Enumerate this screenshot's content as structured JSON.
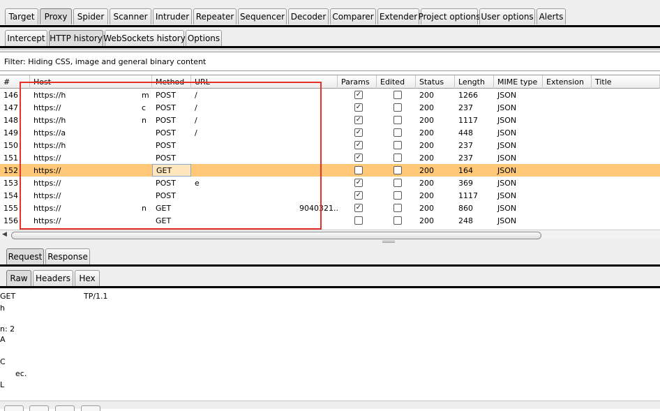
{
  "main_tabs": [
    "Target",
    "Proxy",
    "Spider",
    "Scanner",
    "Intruder",
    "Repeater",
    "Sequencer",
    "Decoder",
    "Comparer",
    "Extender",
    "Project options",
    "User options",
    "Alerts"
  ],
  "proxy_tabs": [
    "Intercept",
    "HTTP history",
    "WebSockets history",
    "Options"
  ],
  "filter": {
    "text": "Filter: Hiding CSS, image and general binary content"
  },
  "table": {
    "headers": [
      "#",
      "Host",
      "Method",
      "URL",
      "Params",
      "Edited",
      "Status",
      "Length",
      "MIME type",
      "Extension",
      "Title"
    ],
    "rows": [
      {
        "num": "146",
        "host": "https://h",
        "host_tail": "m",
        "method": "POST",
        "url": "/",
        "params": true,
        "edited": false,
        "status": "200",
        "length": "1266",
        "mime": "JSON"
      },
      {
        "num": "147",
        "host": "https://",
        "host_tail": "c",
        "method": "POST",
        "url": "/",
        "params": true,
        "edited": false,
        "status": "200",
        "length": "237",
        "mime": "JSON"
      },
      {
        "num": "148",
        "host": "https://h",
        "host_tail": "n",
        "method": "POST",
        "url": "/",
        "params": true,
        "edited": false,
        "status": "200",
        "length": "1117",
        "mime": "JSON"
      },
      {
        "num": "149",
        "host": "https://a",
        "host_tail": "",
        "method": "POST",
        "url": "/",
        "params": true,
        "edited": false,
        "status": "200",
        "length": "448",
        "mime": "JSON"
      },
      {
        "num": "150",
        "host": "https://h",
        "host_tail": "",
        "method": "POST",
        "url": "",
        "params": true,
        "edited": false,
        "status": "200",
        "length": "237",
        "mime": "JSON"
      },
      {
        "num": "151",
        "host": "https://",
        "host_tail": "",
        "method": "POST",
        "url": "",
        "params": true,
        "edited": false,
        "status": "200",
        "length": "237",
        "mime": "JSON"
      },
      {
        "num": "152",
        "host": "https://",
        "host_tail": "",
        "method": "GET",
        "url": "",
        "params": false,
        "edited": false,
        "status": "200",
        "length": "164",
        "mime": "JSON"
      },
      {
        "num": "153",
        "host": "https://",
        "host_tail": "",
        "method": "POST",
        "url": "e",
        "params": true,
        "edited": false,
        "status": "200",
        "length": "369",
        "mime": "JSON"
      },
      {
        "num": "154",
        "host": "https://",
        "host_tail": "",
        "method": "POST",
        "url": "",
        "params": true,
        "edited": false,
        "status": "200",
        "length": "1117",
        "mime": "JSON"
      },
      {
        "num": "155",
        "host": "https://",
        "host_tail": "n",
        "method": "GET",
        "url": "9040321...",
        "params": true,
        "edited": false,
        "status": "200",
        "length": "860",
        "mime": "JSON"
      },
      {
        "num": "156",
        "host": "https://",
        "host_tail": "",
        "method": "GET",
        "url": "",
        "params": false,
        "edited": false,
        "status": "200",
        "length": "248",
        "mime": "JSON"
      }
    ],
    "selected_index": 6
  },
  "detail_tabs": [
    "Request",
    "Response"
  ],
  "view_tabs": [
    "Raw",
    "Headers",
    "Hex"
  ],
  "raw_lines": [
    "GET",
    "TP/1.1",
    "h",
    "n: 2",
    "A",
    "C",
    "ec.",
    "L"
  ],
  "colors": {
    "selected_row": "#ffc879",
    "annotation_box": "#e8302a"
  }
}
